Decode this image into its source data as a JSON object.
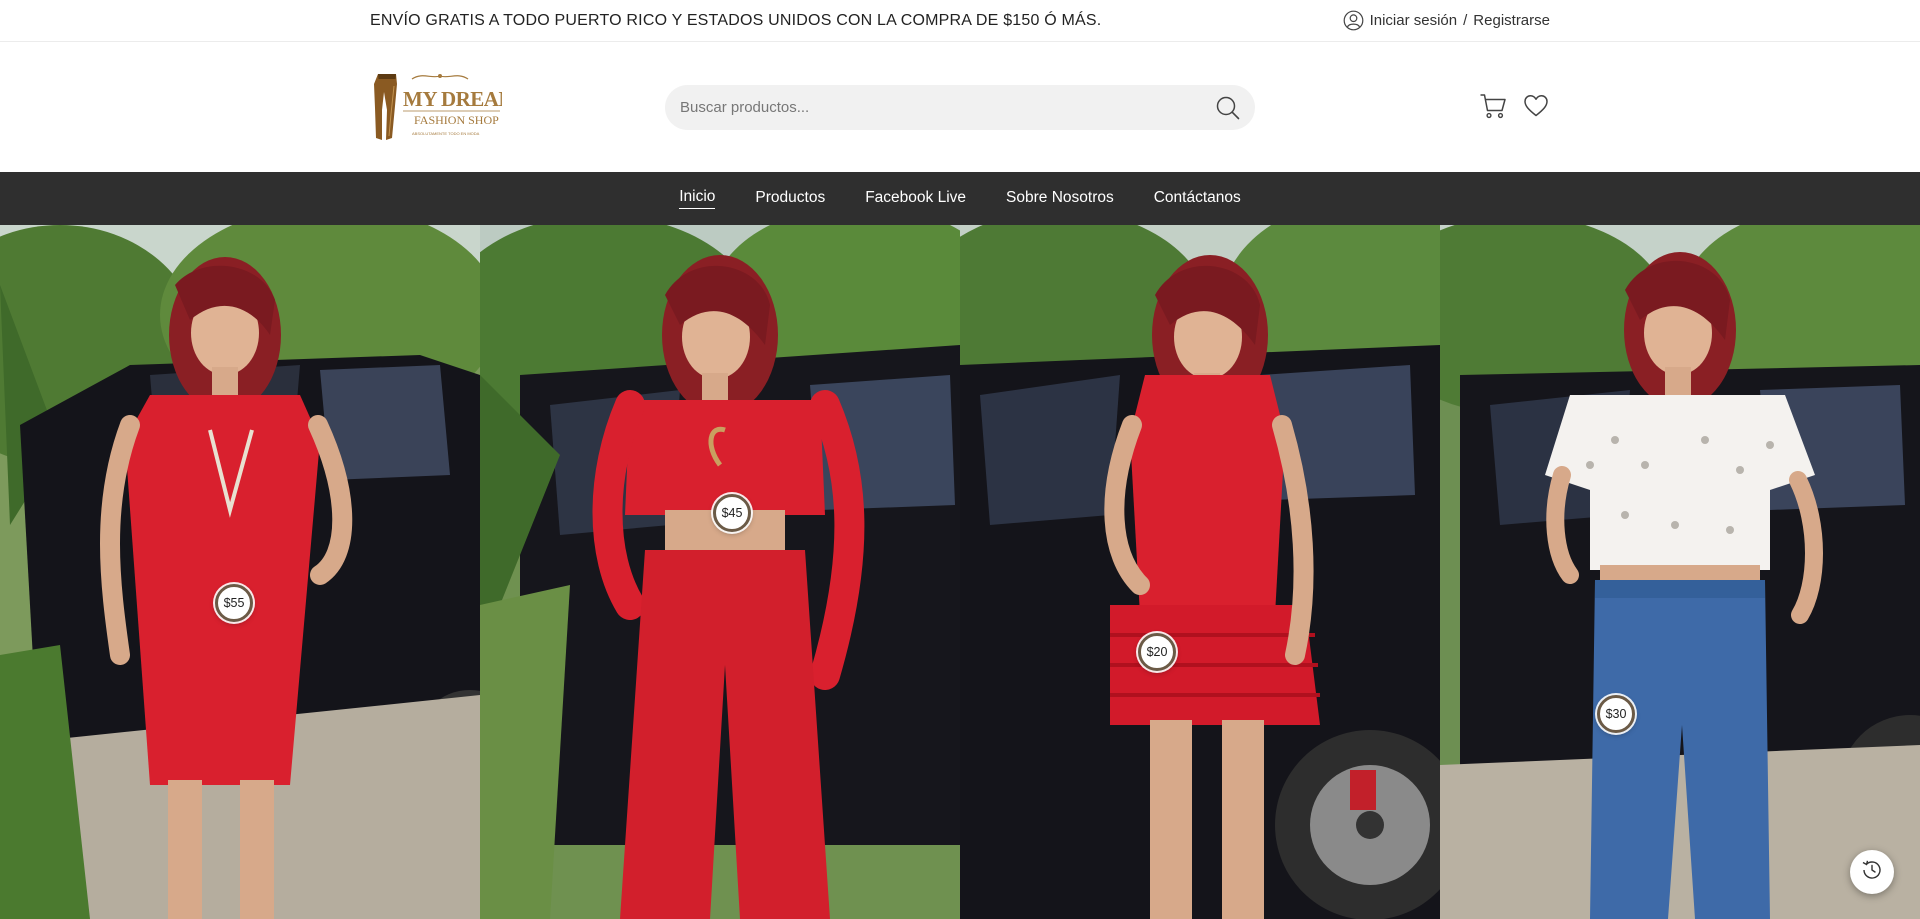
{
  "topbar": {
    "promo": "ENVÍO GRATIS A TODO PUERTO RICO Y ESTADOS UNIDOS CON LA COMPRA DE $150 Ó MÁS.",
    "login": "Iniciar sesión",
    "separator": "/",
    "register": "Registrarse"
  },
  "header": {
    "logo": {
      "line1": "MY DREAM",
      "line2": "FASHION SHOP",
      "tagline": "ABSOLUTAMENTE TODO EN MODA"
    },
    "search_placeholder": "Buscar productos..."
  },
  "nav": {
    "items": [
      {
        "label": "Inicio",
        "active": true
      },
      {
        "label": "Productos"
      },
      {
        "label": "Facebook Live"
      },
      {
        "label": "Sobre Nosotros"
      },
      {
        "label": "Contáctanos"
      }
    ]
  },
  "gallery": {
    "items": [
      {
        "outfit": "red dress",
        "price": "$55"
      },
      {
        "outfit": "red crop top and wide-leg pants",
        "price": "$45"
      },
      {
        "outfit": "red bodysuit and ruffle shorts",
        "price": "$20"
      },
      {
        "outfit": "white eyelet blouse and flare jeans",
        "price": "$30"
      }
    ]
  },
  "colors": {
    "nav_bg": "#2f2f2f",
    "logo_gold": "#a57a3d",
    "outfit_red": "#d9202e",
    "jeans_blue": "#3e6aa8"
  }
}
